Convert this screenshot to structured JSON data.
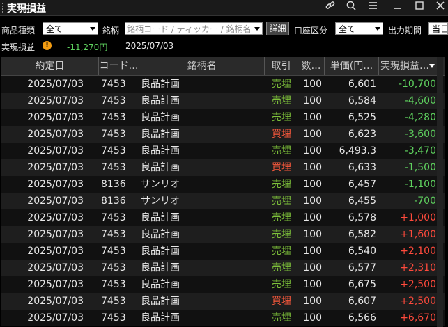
{
  "window": {
    "title": "実現損益",
    "icons": [
      "link-icon",
      "search-icon",
      "menu-icon",
      "minimize-icon",
      "maximize-icon",
      "close-icon"
    ]
  },
  "toolbar": {
    "product_type_label": "商品種類",
    "product_type_value": "全て",
    "symbol_label": "銘柄",
    "symbol_placeholder": "銘柄コード / ティッカー / 銘柄名",
    "detail_button": "詳細",
    "account_type_label": "口座区分",
    "account_type_value": "全て",
    "output_period_label": "出力期間",
    "output_period_value": "当日"
  },
  "summary": {
    "label": "実現損益",
    "warning_glyph": "!",
    "value": "-11,270円",
    "date": "2025/07/03"
  },
  "colors": {
    "sell": "#7ec23a",
    "buy": "#ff5a3c",
    "profit_negative": "#5fd35f",
    "profit_positive": "#ff4a3c",
    "warning": "#f39c12"
  },
  "table": {
    "columns": [
      "約定日",
      "コード…",
      "銘柄名",
      "取引",
      "数…",
      "単価(円…",
      "実現損益…"
    ],
    "rows": [
      {
        "date": "2025/07/03",
        "code": "7453",
        "name": "良品計画",
        "side": "売埋",
        "qty": "100",
        "price": "6,601",
        "pl": "-10,700"
      },
      {
        "date": "2025/07/03",
        "code": "7453",
        "name": "良品計画",
        "side": "売埋",
        "qty": "100",
        "price": "6,584",
        "pl": "-4,600"
      },
      {
        "date": "2025/07/03",
        "code": "7453",
        "name": "良品計画",
        "side": "売埋",
        "qty": "100",
        "price": "6,525",
        "pl": "-4,280"
      },
      {
        "date": "2025/07/03",
        "code": "7453",
        "name": "良品計画",
        "side": "買埋",
        "qty": "100",
        "price": "6,623",
        "pl": "-3,600"
      },
      {
        "date": "2025/07/03",
        "code": "7453",
        "name": "良品計画",
        "side": "売埋",
        "qty": "100",
        "price": "6,493.3",
        "pl": "-3,470"
      },
      {
        "date": "2025/07/03",
        "code": "7453",
        "name": "良品計画",
        "side": "買埋",
        "qty": "100",
        "price": "6,633",
        "pl": "-1,500"
      },
      {
        "date": "2025/07/03",
        "code": "8136",
        "name": "サンリオ",
        "side": "売埋",
        "qty": "100",
        "price": "6,457",
        "pl": "-1,100"
      },
      {
        "date": "2025/07/03",
        "code": "8136",
        "name": "サンリオ",
        "side": "売埋",
        "qty": "100",
        "price": "6,455",
        "pl": "-700"
      },
      {
        "date": "2025/07/03",
        "code": "7453",
        "name": "良品計画",
        "side": "売埋",
        "qty": "100",
        "price": "6,578",
        "pl": "+1,000"
      },
      {
        "date": "2025/07/03",
        "code": "7453",
        "name": "良品計画",
        "side": "売埋",
        "qty": "100",
        "price": "6,582",
        "pl": "+1,600"
      },
      {
        "date": "2025/07/03",
        "code": "7453",
        "name": "良品計画",
        "side": "売埋",
        "qty": "100",
        "price": "6,540",
        "pl": "+2,100"
      },
      {
        "date": "2025/07/03",
        "code": "7453",
        "name": "良品計画",
        "side": "売埋",
        "qty": "100",
        "price": "6,577",
        "pl": "+2,310"
      },
      {
        "date": "2025/07/03",
        "code": "7453",
        "name": "良品計画",
        "side": "売埋",
        "qty": "100",
        "price": "6,675",
        "pl": "+2,500"
      },
      {
        "date": "2025/07/03",
        "code": "7453",
        "name": "良品計画",
        "side": "買埋",
        "qty": "100",
        "price": "6,607",
        "pl": "+2,500"
      },
      {
        "date": "2025/07/03",
        "code": "7453",
        "name": "良品計画",
        "side": "売埋",
        "qty": "100",
        "price": "6,566",
        "pl": "+6,670"
      }
    ]
  }
}
